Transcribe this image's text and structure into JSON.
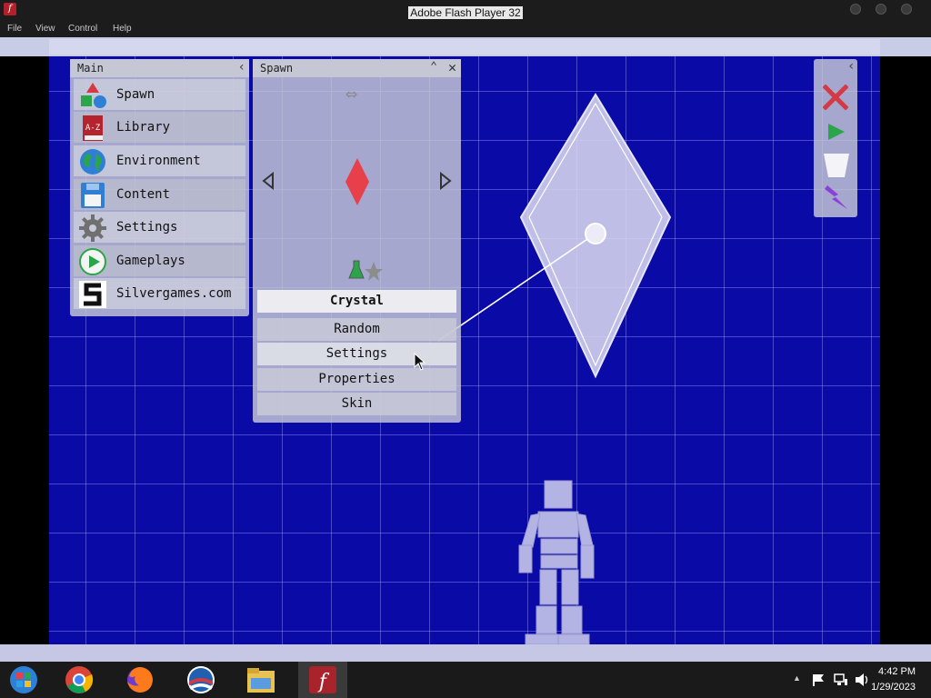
{
  "window": {
    "title": "Adobe Flash Player 32",
    "app_icon": "flash-icon"
  },
  "menubar": {
    "file": "File",
    "view": "View",
    "control": "Control",
    "help": "Help"
  },
  "main_panel": {
    "title": "Main",
    "items": [
      {
        "label": "Spawn",
        "icon": "spawn-shapes-icon"
      },
      {
        "label": "Library",
        "icon": "library-book-icon"
      },
      {
        "label": "Environment",
        "icon": "globe-icon"
      },
      {
        "label": "Content",
        "icon": "floppy-disk-icon"
      },
      {
        "label": "Settings",
        "icon": "gear-icon"
      },
      {
        "label": "Gameplays",
        "icon": "play-circle-icon"
      },
      {
        "label": "Silvergames.com",
        "icon": "silvergames-logo-icon"
      }
    ]
  },
  "spawn_panel": {
    "title": "Spawn",
    "selected_item": "Crystal",
    "options": [
      "Random",
      "Settings",
      "Properties",
      "Skin"
    ],
    "colors": {
      "crystal": "#e8404a"
    }
  },
  "tool_panel": {
    "tools": [
      "delete-icon",
      "play-icon",
      "bucket-icon",
      "lightning-icon"
    ]
  },
  "colors": {
    "stage": "#0a0aa6",
    "grid": "#8c8cf0",
    "panel": "#c8cad7"
  },
  "taskbar": {
    "apps": [
      "windows-start-icon",
      "chrome-icon",
      "firefox-icon",
      "obama-logo-icon",
      "file-explorer-icon",
      "flash-player-icon"
    ],
    "time": "4:42 PM",
    "date": "1/29/2023"
  }
}
